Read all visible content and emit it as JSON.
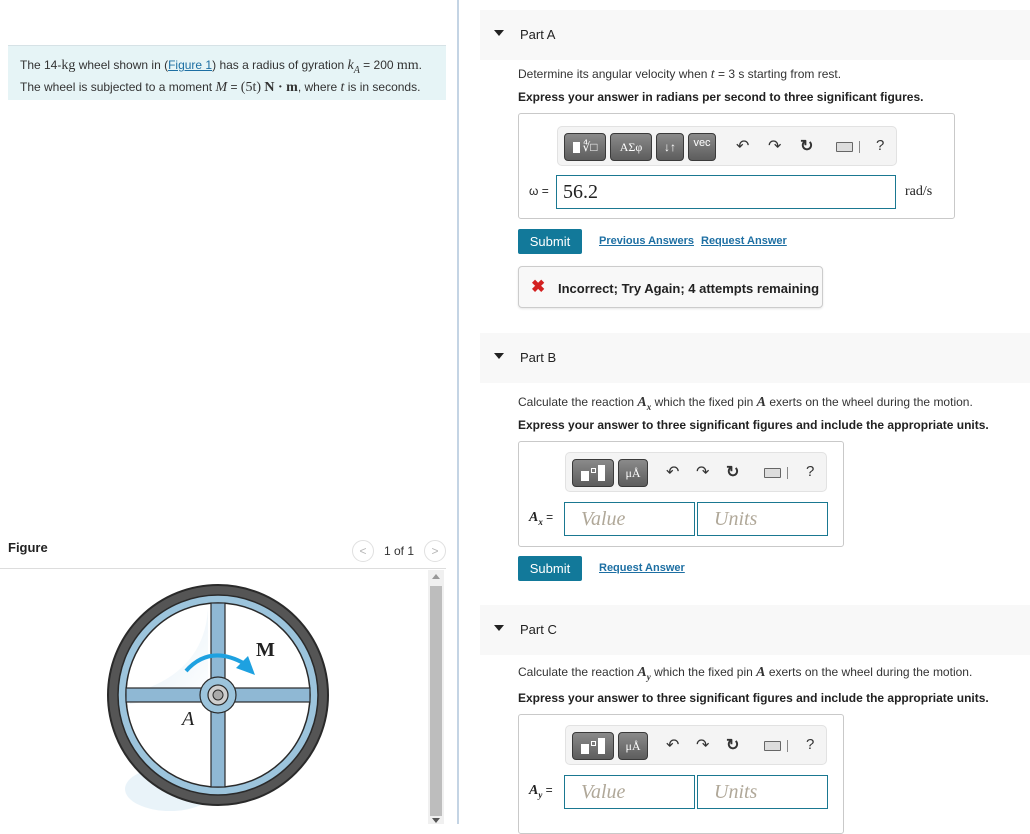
{
  "problem": {
    "text_1": "The 14-",
    "mass_unit": "kg",
    "text_2": " wheel shown in (",
    "figure_link": "Figure 1",
    "text_3": ") has a radius of gyration ",
    "k_symbol": "k",
    "k_sub": "A",
    "text_4": " = 200 ",
    "len_unit": "mm",
    "text_5": ".",
    "line2_1": "The wheel is subjected to a moment ",
    "M_symbol": "M",
    "line2_2": " = ",
    "moment_expr": "(5t)",
    "moment_unit": "N · m",
    "line2_3": ", where ",
    "t_symbol": "t",
    "line2_4": " is in seconds."
  },
  "figure": {
    "title": "Figure",
    "counter": "1 of 1",
    "prev_icon": "chevron-left-icon",
    "next_icon": "chevron-right-icon",
    "label_M": "M",
    "label_A": "A",
    "colors": {
      "rim": "#5a5a5a",
      "spoke": "#8fb8d4",
      "arrow": "#1ea1e0"
    }
  },
  "parts": [
    {
      "title": "Part A",
      "prompt_1": "Determine its angular velocity when ",
      "prompt_var": "t",
      "prompt_2": " = 3 s starting from rest.",
      "instruction": "Express your answer in radians per second to three significant figures.",
      "toolbar": [
        "templates",
        "ΑΣφ",
        "↓↑",
        "vec"
      ],
      "var_label": "ω =",
      "answer_value": "56.2",
      "unit": "rad/s",
      "submit_label": "Submit",
      "links": [
        "Previous Answers",
        "Request Answer"
      ],
      "feedback": "Incorrect; Try Again; 4 attempts remaining"
    },
    {
      "title": "Part B",
      "prompt_1": "Calculate the reaction ",
      "prompt_var": "Ax",
      "prompt_2": " which the fixed pin ",
      "prompt_var2": "A",
      "prompt_3": " exerts on the wheel during the motion.",
      "instruction": "Express your answer to three significant figures and include the appropriate units.",
      "toolbar": [
        "templates",
        "μÅ"
      ],
      "var_label_main": "A",
      "var_label_sub": "x",
      "value_placeholder": "Value",
      "units_placeholder": "Units",
      "submit_label": "Submit",
      "links": [
        "Request Answer"
      ]
    },
    {
      "title": "Part C",
      "prompt_1": "Calculate the reaction ",
      "prompt_var": "Ay",
      "prompt_2": " which the fixed pin ",
      "prompt_var2": "A",
      "prompt_3": " exerts on the wheel during the motion.",
      "instruction": "Express your answer to three significant figures and include the appropriate units.",
      "toolbar": [
        "templates",
        "μÅ"
      ],
      "var_label_main": "A",
      "var_label_sub": "y",
      "value_placeholder": "Value",
      "units_placeholder": "Units"
    }
  ],
  "toolbar_icons": {
    "undo": "↶",
    "redo": "↷",
    "reset": "↻",
    "help": "?"
  },
  "colors": {
    "accent": "#12799a",
    "link": "#1d6fa3",
    "error": "#d32020",
    "problem_bg": "#e6f4f6"
  }
}
